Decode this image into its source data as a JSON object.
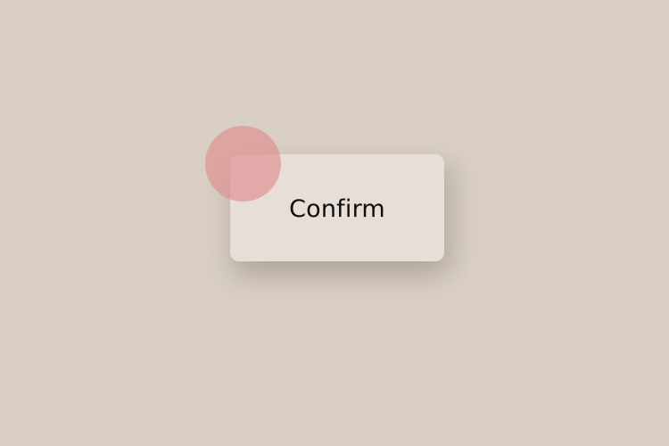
{
  "confirm_card": {
    "label": "Confirm"
  },
  "accent": {
    "name": "decorative-circle",
    "color": "#de9192"
  },
  "colors": {
    "background": "#d9cfc4",
    "card": "#e8ded8"
  }
}
